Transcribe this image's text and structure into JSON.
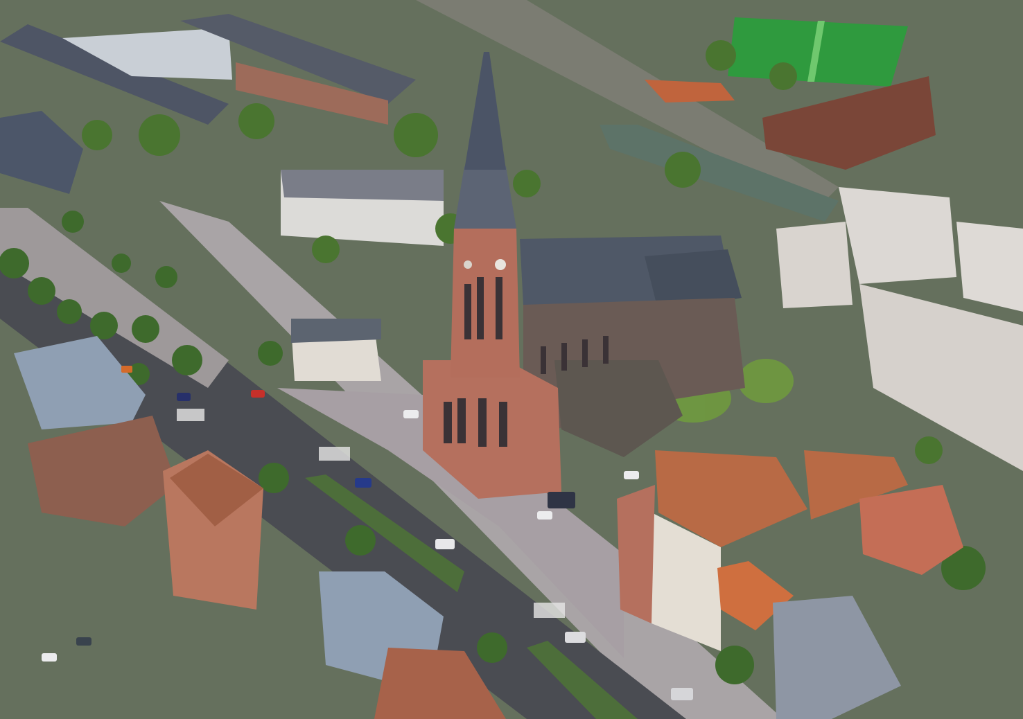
{
  "scene": {
    "kind": "aerial-urban-rendering",
    "palette": {
      "grass": "#3f6d3a",
      "pitch": "#2f9a3e",
      "asphalt": "#4a4c52",
      "sidewalk": "#a9a4a6",
      "plaza": "#a79fa4",
      "brick": "#b5705e",
      "slate": "#4f5867",
      "zinc": "#8f9fb3",
      "terracotta": "#c0643d",
      "water": "#5d7368",
      "tree": "#3e6a2c",
      "tree_light": "#6f9a3f",
      "white_block": "#d9d4cf"
    }
  }
}
